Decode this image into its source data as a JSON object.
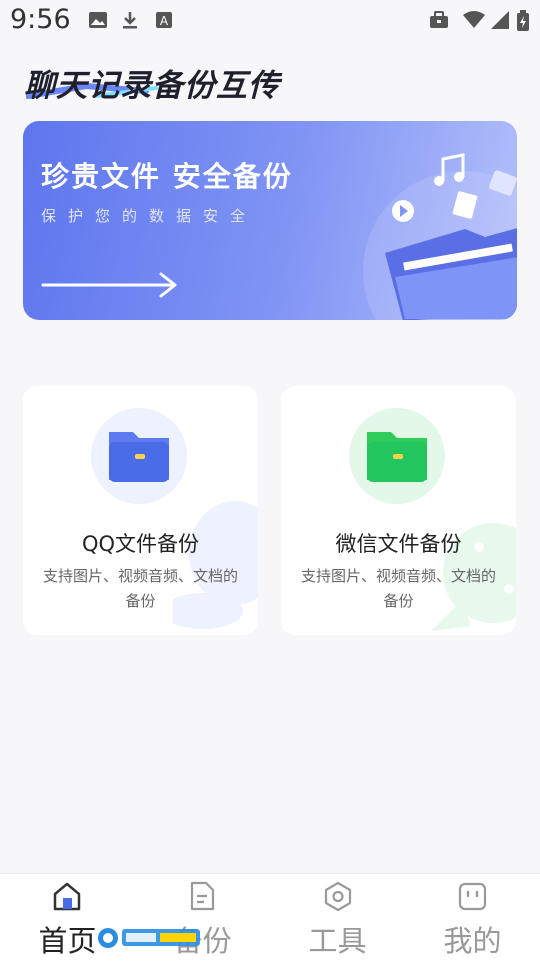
{
  "status_bar": {
    "time": "9:56",
    "icons": [
      "image-icon",
      "download-icon",
      "font-a-icon",
      "briefcase-icon",
      "wifi-icon",
      "signal-icon",
      "battery-charging-icon"
    ]
  },
  "app": {
    "title": "聊天记录备份互传"
  },
  "banner": {
    "title": "珍贵文件 安全备份",
    "subtitle": "保护您的数据安全",
    "colors": {
      "start": "#5e76ee",
      "end": "#b4c0fb"
    }
  },
  "cards": [
    {
      "key": "qq",
      "title": "QQ文件备份",
      "description": "支持图片、视频音频、文档的备份",
      "accent": "#4f7bf0",
      "icon": "folder-icon"
    },
    {
      "key": "wechat",
      "title": "微信文件备份",
      "description": "支持图片、视频音频、文档的备份",
      "accent": "#22c55e",
      "icon": "folder-icon"
    }
  ],
  "bottom_nav": [
    {
      "label": "首页",
      "icon": "home-icon",
      "active": true
    },
    {
      "label": "备份",
      "icon": "document-icon",
      "active": false
    },
    {
      "label": "工具",
      "icon": "hexagon-tool-icon",
      "active": false
    },
    {
      "label": "我的",
      "icon": "profile-face-icon",
      "active": false
    }
  ]
}
